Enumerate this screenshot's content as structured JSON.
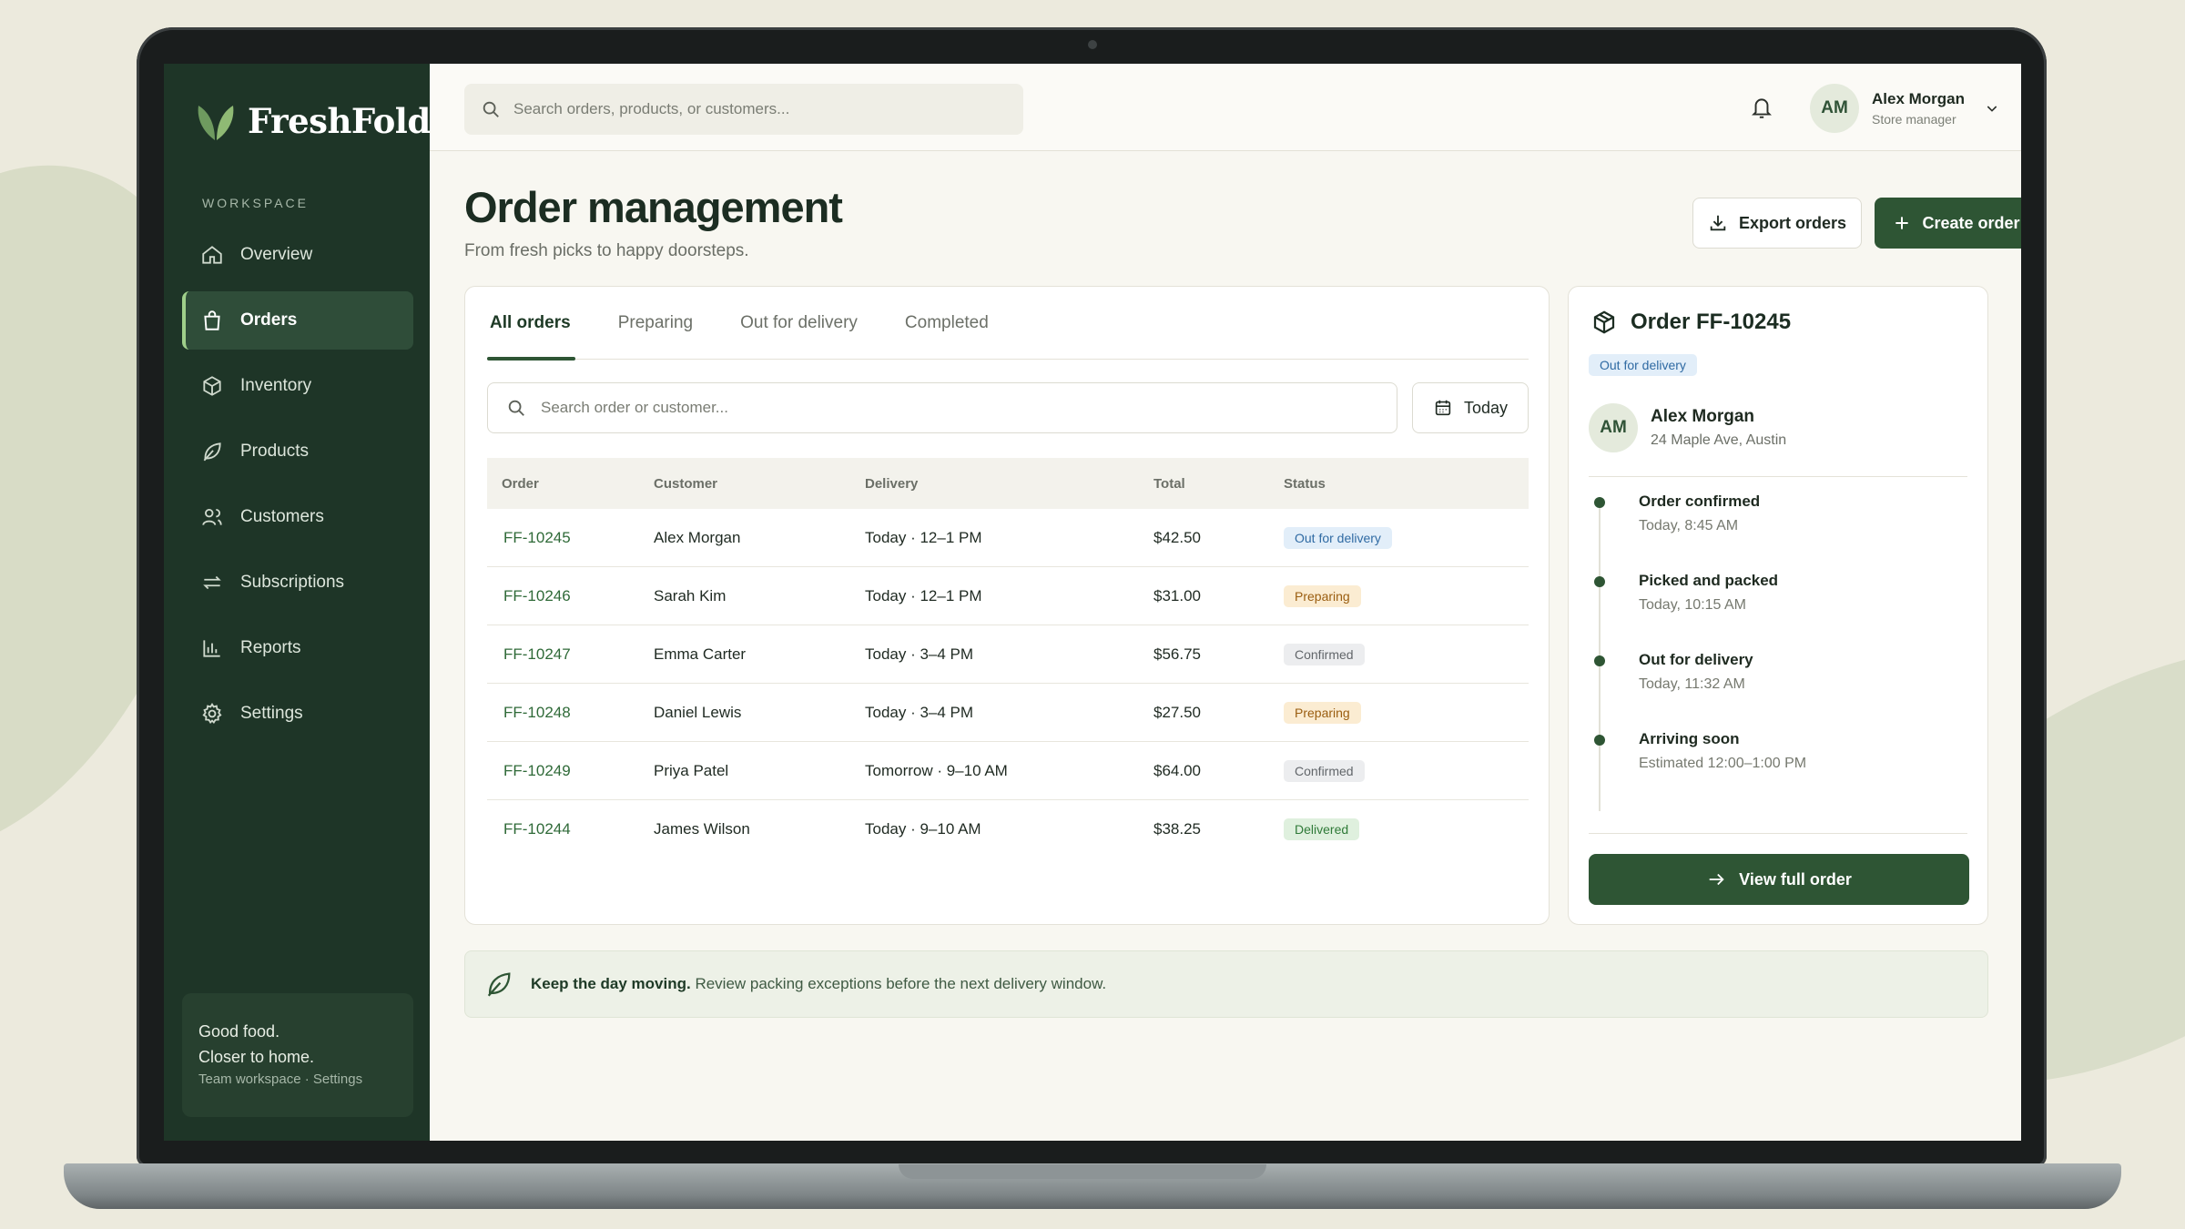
{
  "app": {
    "name": "FreshFold",
    "workspace_label": "WORKSPACE",
    "footer_line1": "Good food.",
    "footer_line2": "Closer to home.",
    "footer_line3": "Team workspace · Settings"
  },
  "sidebar": {
    "items": [
      {
        "label": "Overview",
        "icon": "home-icon"
      },
      {
        "label": "Orders",
        "icon": "shopping-bag-icon",
        "active": true
      },
      {
        "label": "Inventory",
        "icon": "box-icon"
      },
      {
        "label": "Products",
        "icon": "leaf-icon"
      },
      {
        "label": "Customers",
        "icon": "users-icon"
      },
      {
        "label": "Subscriptions",
        "icon": "repeat-icon"
      },
      {
        "label": "Reports",
        "icon": "bar-chart-icon"
      },
      {
        "label": "Settings",
        "icon": "gear-icon"
      }
    ]
  },
  "topbar": {
    "search_placeholder": "Search orders, products, or customers...",
    "user_initials": "AM",
    "user_name": "Alex Morgan",
    "user_role": "Store manager"
  },
  "header": {
    "title": "Order management",
    "subtitle": "From fresh picks to happy doorsteps.",
    "export_label": "Export orders",
    "create_label": "Create order"
  },
  "orders": {
    "tabs": [
      "All orders",
      "Preparing",
      "Out for delivery",
      "Completed"
    ],
    "search_placeholder": "Search order or customer...",
    "date_filter": "Today",
    "columns": [
      "Order",
      "Customer",
      "Delivery",
      "Total",
      "Status"
    ],
    "rows": [
      {
        "order": "FF-10245",
        "customer": "Alex Morgan",
        "delivery": "Today · 12–1 PM",
        "total": "$42.50",
        "status": "Out for delivery",
        "status_type": "out"
      },
      {
        "order": "FF-10246",
        "customer": "Sarah Kim",
        "delivery": "Today · 12–1 PM",
        "total": "$31.00",
        "status": "Preparing",
        "status_type": "prep"
      },
      {
        "order": "FF-10247",
        "customer": "Emma Carter",
        "delivery": "Today · 3–4 PM",
        "total": "$56.75",
        "status": "Confirmed",
        "status_type": "conf"
      },
      {
        "order": "FF-10248",
        "customer": "Daniel Lewis",
        "delivery": "Today · 3–4 PM",
        "total": "$27.50",
        "status": "Preparing",
        "status_type": "prep"
      },
      {
        "order": "FF-10249",
        "customer": "Priya Patel",
        "delivery": "Tomorrow · 9–10 AM",
        "total": "$64.00",
        "status": "Confirmed",
        "status_type": "conf"
      },
      {
        "order": "FF-10244",
        "customer": "James Wilson",
        "delivery": "Today · 9–10 AM",
        "total": "$38.25",
        "status": "Delivered",
        "status_type": "deliv"
      }
    ]
  },
  "detail": {
    "title": "Order FF-10245",
    "status": "Out for delivery",
    "customer_initials": "AM",
    "customer_name": "Alex Morgan",
    "customer_address": "24 Maple Ave, Austin",
    "timeline": [
      {
        "title": "Order confirmed",
        "time": "Today, 8:45 AM"
      },
      {
        "title": "Picked and packed",
        "time": "Today, 10:15 AM"
      },
      {
        "title": "Out for delivery",
        "time": "Today, 11:32 AM"
      },
      {
        "title": "Arriving soon",
        "time": "Estimated 12:00–1:00 PM"
      }
    ],
    "view_label": "View full order"
  },
  "tip": {
    "bold": "Keep the day moving.",
    "text": "Review packing exceptions before the next delivery window."
  },
  "colors": {
    "sidebar": "#1e3527",
    "accent": "#2e5534",
    "background": "#f8f7f1"
  }
}
